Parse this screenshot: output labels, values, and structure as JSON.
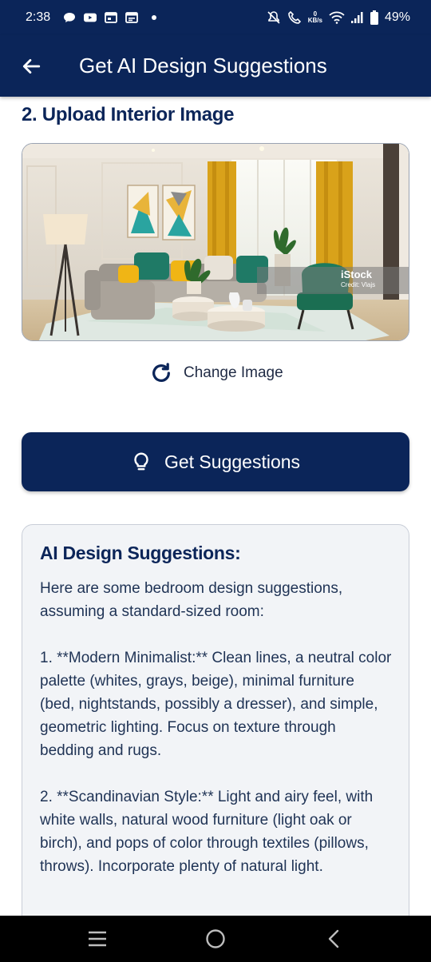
{
  "status_bar": {
    "time": "2:38",
    "network_speed_value": "0",
    "network_speed_unit": "KB/s",
    "battery": "49%"
  },
  "app_bar": {
    "title": "Get AI Design Suggestions"
  },
  "upload_section": {
    "title": "2. Upload Interior Image",
    "watermark_brand": "iStock",
    "watermark_credit": "Credit: Vlajs",
    "change_image_label": "Change Image"
  },
  "get_suggestions_label": "Get Suggestions",
  "suggestions": {
    "heading": "AI Design Suggestions:",
    "paragraphs": [
      "Here are some bedroom design suggestions, assuming a standard-sized room:",
      "1. **Modern Minimalist:** Clean lines, a neutral color palette (whites, grays, beige),  minimal furniture (bed, nightstands, possibly a dresser), and simple, geometric lighting.  Focus on texture through bedding and rugs.",
      "2. **Scandinavian Style:** Light and airy feel, with white walls, natural wood furniture (light oak or birch),  and pops of color through textiles (pillows, throws).  Incorporate plenty of natural light."
    ]
  },
  "colors": {
    "primary": "#0b2559",
    "card_background": "#f2f4f7",
    "nav_bar": "#000000"
  },
  "icons": {
    "back": "arrow-left-icon",
    "change_image": "refresh-icon",
    "get_suggestions": "lightbulb-icon",
    "nav_recents": "menu-lines-icon",
    "nav_home": "circle-home-icon",
    "nav_back": "chevron-left-icon"
  }
}
